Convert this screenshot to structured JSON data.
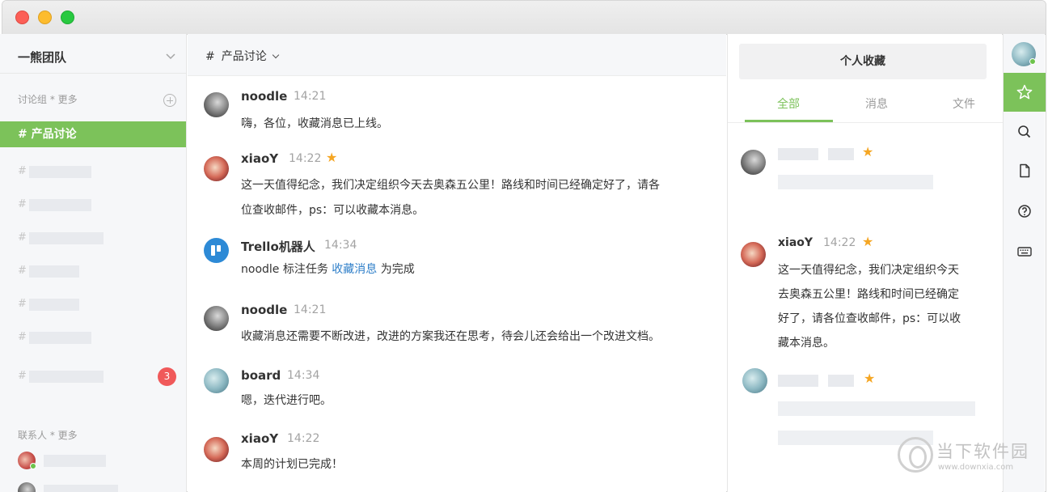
{
  "window": {
    "controls": [
      "close",
      "minimize",
      "zoom"
    ]
  },
  "sidebar": {
    "team_name": "一熊团队",
    "groups_label": "讨论组 * 更多",
    "active_channel": "# 产品讨论",
    "hash": "#",
    "unread_badge": "3",
    "contacts_label": "联系人 * 更多"
  },
  "main": {
    "channel_hash": "#",
    "channel_title": "产品讨论",
    "messages": [
      {
        "name": "noodle",
        "time": "14:21",
        "text": "嗨，各位，收藏消息已上线。"
      },
      {
        "name": "xiaoY",
        "time": "14:22",
        "starred": true,
        "text1": "这一天值得纪念，我们决定组织今天去奥森五公里！路线和时间已经确定好了，请各",
        "text2": "位查收邮件，ps：可以收藏本消息。"
      },
      {
        "name": "Trello机器人",
        "time": "14:34",
        "text_pre": "noodle 标注任务 ",
        "text_link": "收藏消息",
        "text_post": " 为完成"
      },
      {
        "name": "noodle",
        "time": "14:21",
        "text": "收藏消息还需要不断改进，改进的方案我还在思考，待会儿还会给出一个改进文档。"
      },
      {
        "name": "board",
        "time": "14:34",
        "text": "嗯，迭代进行吧。"
      },
      {
        "name": "xiaoY",
        "time": "14:22",
        "text": "本周的计划已完成！"
      }
    ]
  },
  "favorites": {
    "title": "个人收藏",
    "tabs": [
      "全部",
      "消息",
      "文件"
    ],
    "active_tab": "全部",
    "item": {
      "name": "xiaoY",
      "time": "14:22",
      "lines": [
        "这一天值得纪念，我们决定组织今天",
        "去奥森五公里！路线和时间已经确定",
        "好了，请各位查收邮件，ps：可以收",
        "藏本消息。"
      ]
    }
  },
  "rail": {
    "icons": [
      "star-icon",
      "search-icon",
      "file-icon",
      "help-icon",
      "keyboard-icon"
    ]
  },
  "watermark": {
    "text": "当下软件园",
    "url": "www.downxia.com"
  },
  "colors": {
    "accent": "#7cc25a",
    "badge": "#f0595a",
    "star": "#f5a623",
    "link": "#2f7fc9"
  }
}
